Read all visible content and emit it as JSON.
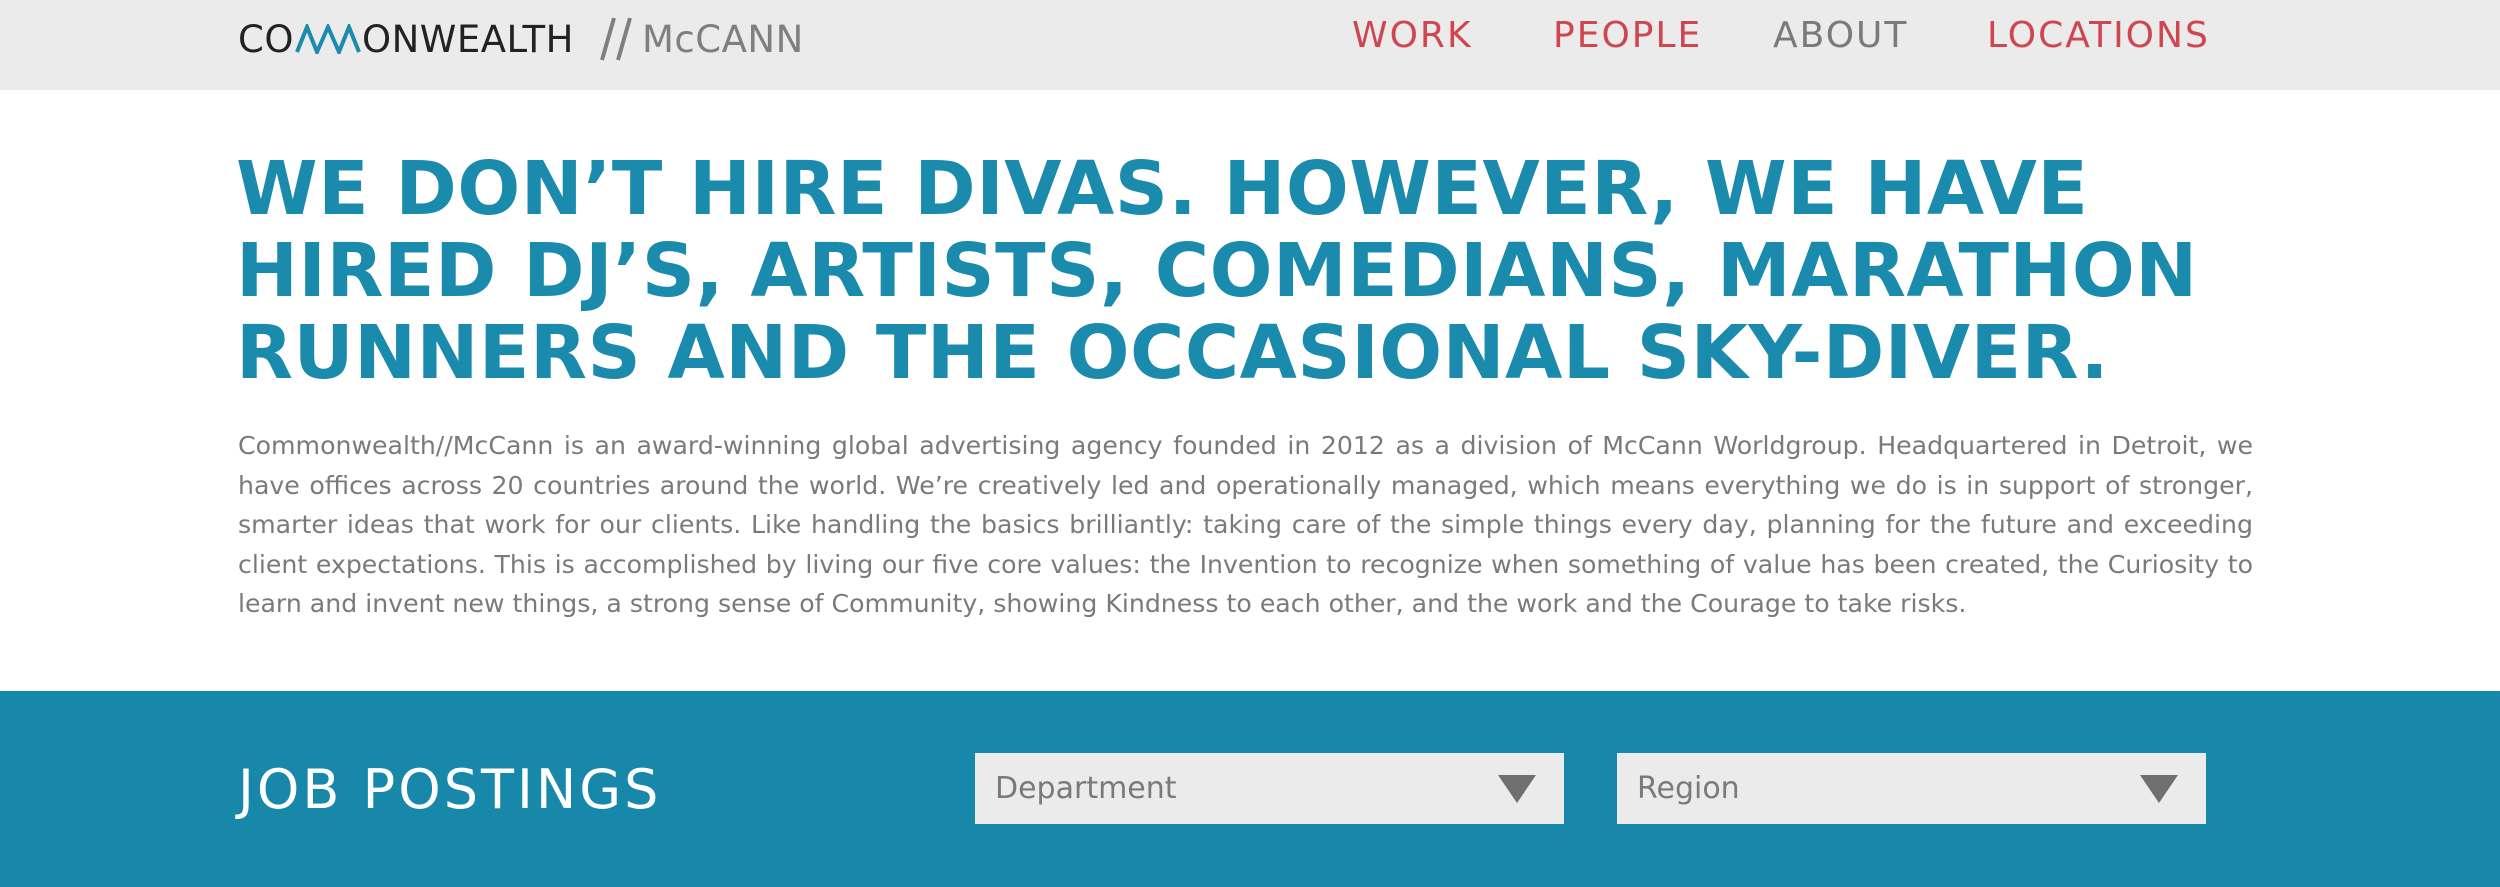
{
  "brand": {
    "part1": "CO",
    "part2": "ONWEALTH",
    "part3": "McCANN",
    "mark_color": "#1a8aad",
    "slash_color": "#7f7f7f"
  },
  "nav": {
    "items": [
      {
        "label": "WORK",
        "color": "#cf4550"
      },
      {
        "label": "PEOPLE",
        "color": "#cf4550"
      },
      {
        "label": "ABOUT",
        "color": "#7a7a7a"
      },
      {
        "label": "LOCATIONS",
        "color": "#cf4550"
      }
    ]
  },
  "hero": {
    "headline_lines": [
      "WE DON’T HIRE DIVAS. HOWEVER, WE HAVE",
      "HIRED DJ’S, ARTISTS, COMEDIANS, MARATHON",
      "RUNNERS AND THE OCCASIONAL SKY-DIVER."
    ],
    "body": "Commonwealth//McCann is an award-winning global advertising agency founded in 2012 as a division of McCann Worldgroup. Headquartered in Detroit, we have offices across 20 countries around the world. We’re creatively led and operationally managed, which means everything we do is in support of stronger, smarter ideas that work for our clients. Like handling the basics brilliantly: taking care of the simple things every day, planning for the future and exceeding client expectations. This is accomplished by living our five core values: the Invention to recognize when something of value has been created, the Curiosity to learn and invent new things, a strong sense of Community, showing Kindness to each other, and the work and the Courage to take risks."
  },
  "jobs": {
    "title": "JOB POSTINGS",
    "department_select": {
      "value": "Department",
      "icon": "caret-down-icon"
    },
    "region_select": {
      "value": "Region",
      "icon": "caret-down-icon"
    }
  },
  "colors": {
    "accent": "#1a8aad",
    "nav_red": "#cf4550",
    "band": "#1788a9",
    "topbar": "#ebebeb"
  }
}
